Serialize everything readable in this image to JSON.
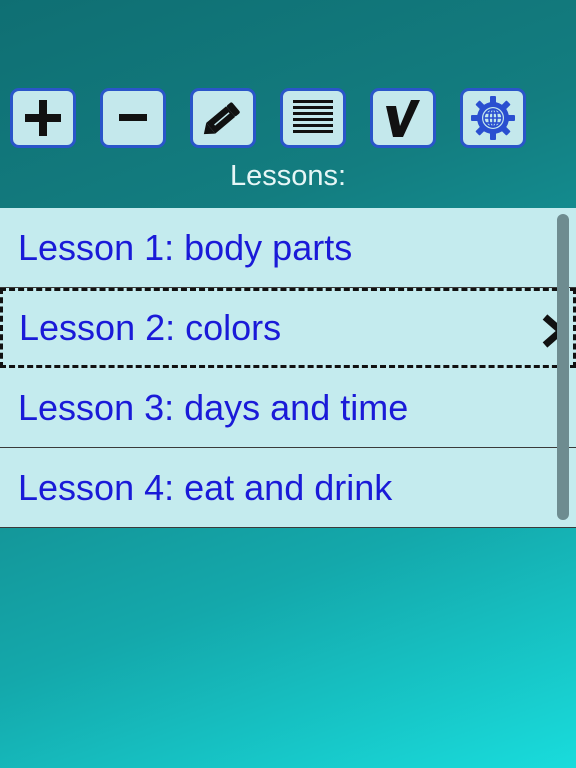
{
  "toolbar": {
    "buttons": [
      {
        "name": "add",
        "icon": "plus-icon"
      },
      {
        "name": "remove",
        "icon": "minus-icon"
      },
      {
        "name": "edit",
        "icon": "pencil-icon"
      },
      {
        "name": "list",
        "icon": "lines-icon"
      },
      {
        "name": "check",
        "icon": "checkmark-icon"
      },
      {
        "name": "settings",
        "icon": "gear-globe-icon"
      }
    ]
  },
  "lessons_label": "Lessons:",
  "lessons": [
    {
      "title": "Lesson 1: body parts"
    },
    {
      "title": "Lesson 2: colors"
    },
    {
      "title": "Lesson 3: days and time"
    },
    {
      "title": "Lesson 4: eat and drink"
    }
  ],
  "selected_index": 1,
  "colors": {
    "button_border": "#2a55c9",
    "button_fill": "#c4e8ec",
    "list_text": "#1a1ad8",
    "list_background": "#c4ebee"
  }
}
